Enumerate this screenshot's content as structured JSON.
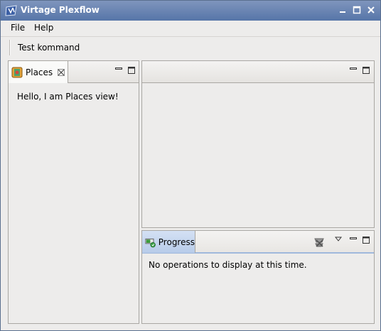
{
  "window": {
    "title": "Virtage Plexflow"
  },
  "menu": {
    "items": [
      "File",
      "Help"
    ]
  },
  "toolbar": {
    "command_label": "Test kommand"
  },
  "places_view": {
    "tab_label": "Places",
    "message": "Hello, I am Places view!"
  },
  "progress_view": {
    "tab_label": "Progress",
    "message": "No operations to display at this time."
  }
}
